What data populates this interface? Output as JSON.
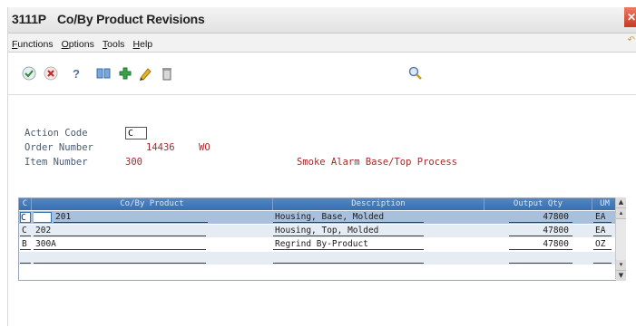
{
  "window": {
    "program_code": "3111P",
    "title": "Co/By Product Revisions",
    "close_glyph": "✕"
  },
  "menu": {
    "items": [
      "Functions",
      "Options",
      "Tools",
      "Help"
    ],
    "arrow_glyph": "↶"
  },
  "toolbar": {
    "icons": [
      "ok-check-icon",
      "cancel-x-icon",
      "help-question-icon",
      "find-icon",
      "add-icon",
      "edit-pencil-icon",
      "delete-trash-icon",
      "search-magnifier-icon"
    ],
    "help_glyph": "?"
  },
  "form": {
    "action_code_label": "Action Code",
    "action_code_value": "C",
    "order_number_label": "Order Number",
    "order_number_value": "14436",
    "order_type": "WO",
    "item_number_label": "Item Number",
    "item_number_value": "300",
    "item_description": "Smoke Alarm Base/Top Process"
  },
  "grid": {
    "headers": {
      "c": "C",
      "product": "Co/By Product",
      "description": "Description",
      "output_qty": "Output Qty",
      "um": "UM"
    },
    "rows": [
      {
        "c": "C",
        "product": "201",
        "description": "Housing, Base, Molded",
        "qty": "47800",
        "um": "EA"
      },
      {
        "c": "C",
        "product": "202",
        "description": "Housing, Top, Molded",
        "qty": "47800",
        "um": "EA"
      },
      {
        "c": "B",
        "product": "300A",
        "description": "Regrind By-Product",
        "qty": "47800",
        "um": "OZ"
      },
      {
        "c": "",
        "product": "",
        "description": "",
        "qty": "",
        "um": ""
      }
    ]
  },
  "colors": {
    "header_blue": "#3a6fb0",
    "selected_row": "#a8c0dc",
    "value_red": "#a8282a",
    "label_gray": "#4a5a6e"
  }
}
